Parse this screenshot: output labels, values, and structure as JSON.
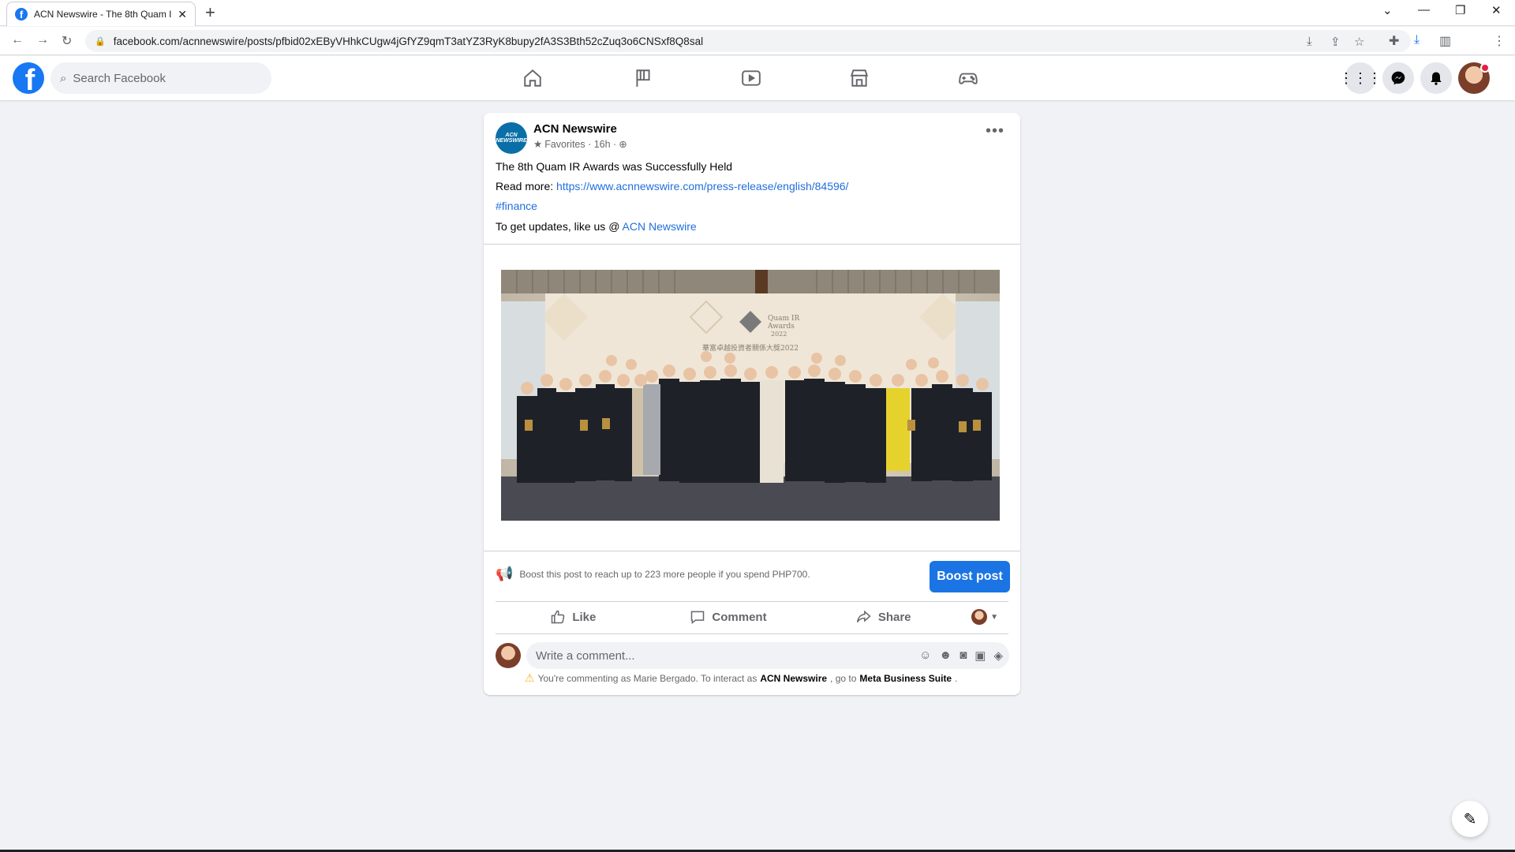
{
  "browser": {
    "tab_title": "ACN Newswire - The 8th Quam I",
    "url": "facebook.com/acnnewswire/posts/pfbid02xEByVHhkCUgw4jGfYZ9qmT3atYZ3RyK8bupy2fA3S3Bth52cZuq3o6CNSxf8Q8sal"
  },
  "header": {
    "search_placeholder": "Search Facebook",
    "nav_icons": [
      "home-icon",
      "pages-flag-icon",
      "watch-video-icon",
      "marketplace-icon",
      "gaming-icon"
    ],
    "right_icons": [
      "menu-grid-icon",
      "messenger-icon",
      "notifications-bell-icon"
    ],
    "brand_color": "#1877f2"
  },
  "post": {
    "page_name": "ACN Newswire",
    "avatar_text": "ACN NEWSWIRE",
    "meta": "Favorites · 16h ·",
    "headline": "The 8th Quam IR Awards was Successfully Held",
    "read_more_label": "Read more:",
    "read_more_url": "https://www.acnnewswire.com/press-release/english/84596/",
    "hashtag": "#finance",
    "updates_prefix": "To get updates, like us @",
    "updates_link": "ACN Newswire",
    "photo_caption_lines": [
      "Quam IR",
      "Awards",
      "2022",
      "華富卓越投資者關係大獎2022"
    ],
    "boost_text": "Boost this post to reach up to 223 more people if you spend PHP700.",
    "boost_button": "Boost post",
    "actions": {
      "like": "Like",
      "comment": "Comment",
      "share": "Share"
    },
    "comment_placeholder": "Write a comment...",
    "notice_prefix": "You're commenting as Marie Bergado. To interact as",
    "notice_page": "ACN Newswire",
    "notice_middle": ", go to",
    "notice_suite": "Meta Business Suite",
    "notice_end": "."
  }
}
